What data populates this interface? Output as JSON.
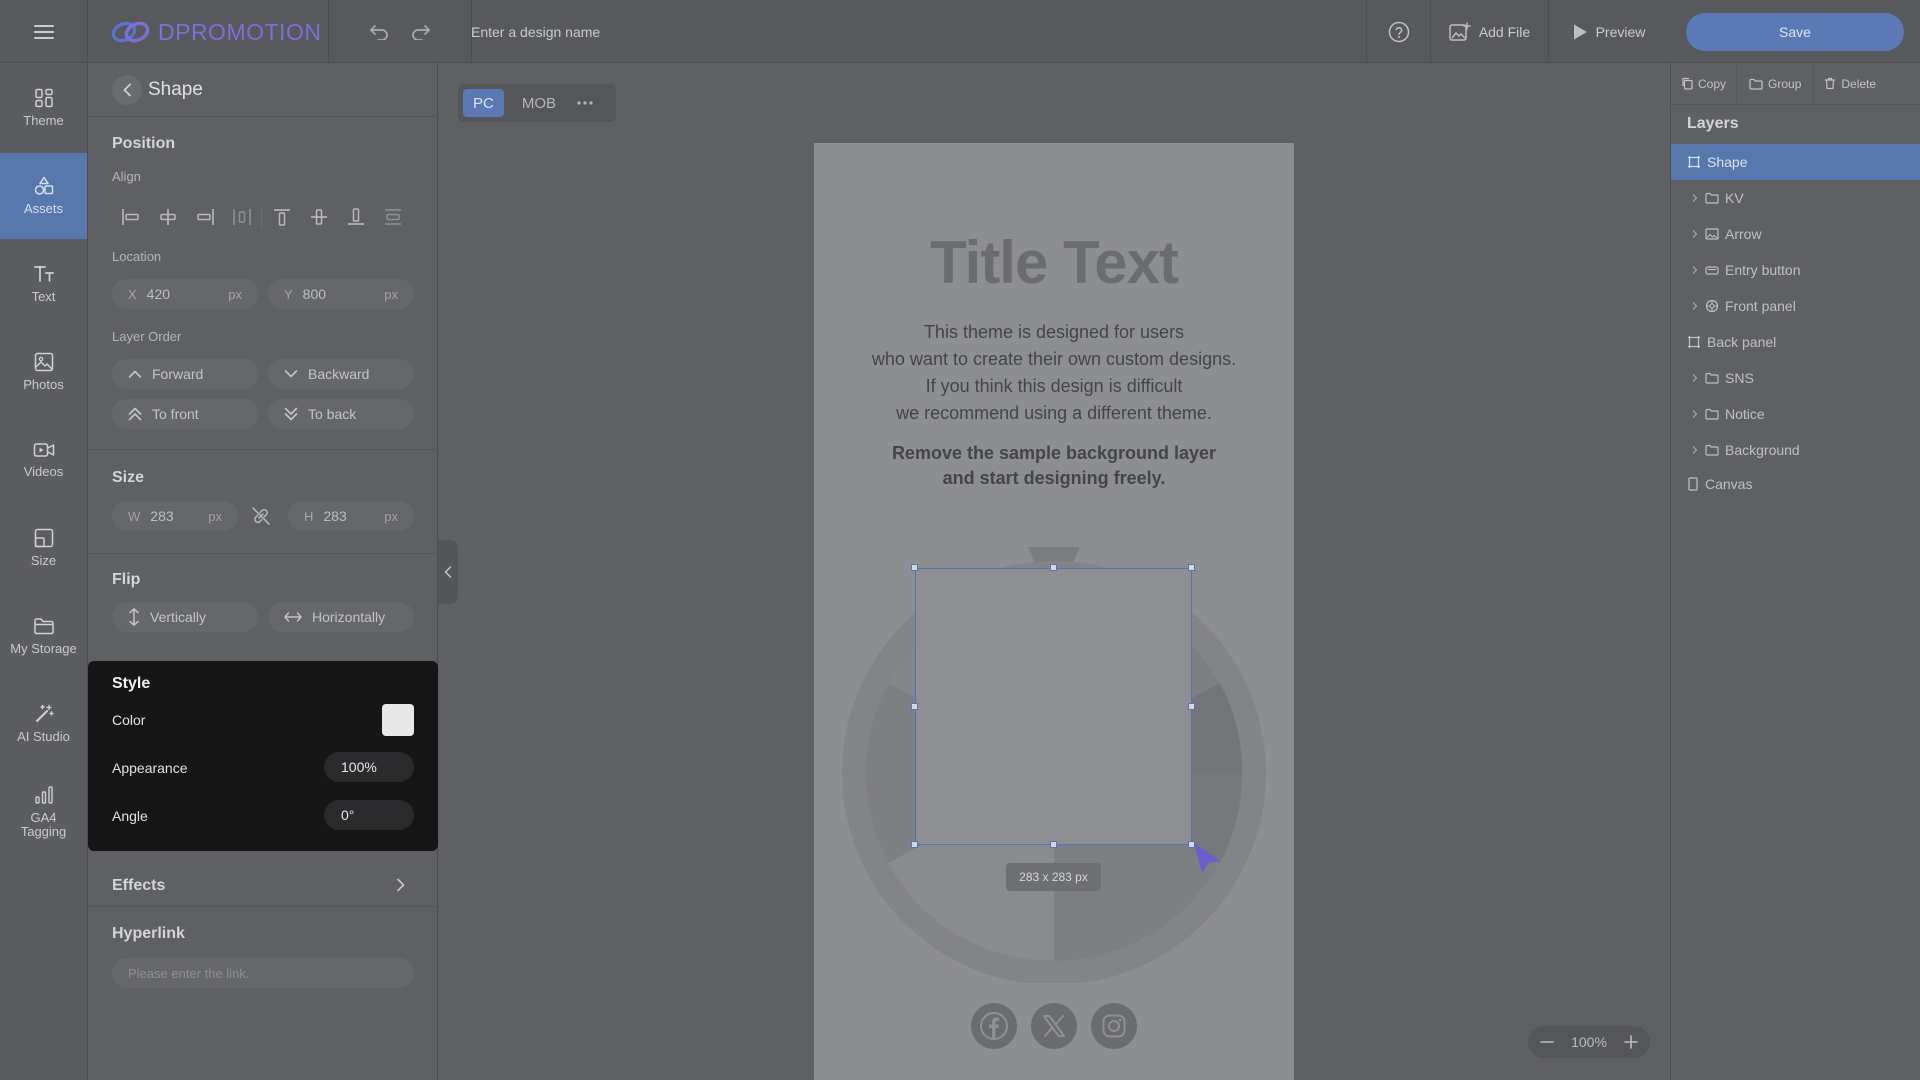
{
  "app": {
    "logo_text": "DPROMOTION",
    "design_name_placeholder": "Enter a design name",
    "add_file_label": "Add File",
    "preview_label": "Preview",
    "save_label": "Save"
  },
  "rail": {
    "items": [
      {
        "label": "Theme",
        "icon": "theme-icon",
        "active": false
      },
      {
        "label": "Assets",
        "icon": "assets-icon",
        "active": true
      },
      {
        "label": "Text",
        "icon": "text-icon",
        "active": false
      },
      {
        "label": "Photos",
        "icon": "photos-icon",
        "active": false
      },
      {
        "label": "Videos",
        "icon": "videos-icon",
        "active": false
      },
      {
        "label": "Size",
        "icon": "size-icon",
        "active": false
      },
      {
        "label": "My Storage",
        "icon": "folder-icon",
        "active": false
      },
      {
        "label": "AI Studio",
        "icon": "magic-wand-icon",
        "active": false
      },
      {
        "label": "GA4 Tagging",
        "icon": "bar-chart-icon",
        "active": false
      }
    ]
  },
  "panel": {
    "title": "Shape",
    "position_title": "Position",
    "align_label": "Align",
    "location_label": "Location",
    "x_key": "X",
    "x_value": "420",
    "y_key": "Y",
    "y_value": "800",
    "unit": "px",
    "layer_order_label": "Layer Order",
    "forward_label": "Forward",
    "backward_label": "Backward",
    "to_front_label": "To front",
    "to_back_label": "To back",
    "size_title": "Size",
    "w_key": "W",
    "w_value": "283",
    "h_key": "H",
    "h_value": "283",
    "flip_title": "Flip",
    "vertically_label": "Vertically",
    "horizontally_label": "Horizontally",
    "style_title": "Style",
    "color_label": "Color",
    "color_value": "#e8e8e8",
    "appearance_label": "Appearance",
    "appearance_value": "100%",
    "angle_label": "Angle",
    "angle_value": "0°",
    "effects_title": "Effects",
    "hyperlink_title": "Hyperlink",
    "hyperlink_placeholder": "Please enter the link."
  },
  "canvas": {
    "tabs": [
      "PC",
      "MOB"
    ],
    "active_tab": "PC",
    "title_text": "Title Text",
    "body_lines": [
      "This theme is designed for users",
      "who want to create their own custom designs.",
      "If you think this design is difficult",
      "we recommend using a different theme."
    ],
    "bold_lines": [
      "Remove the sample background layer",
      "and start designing freely."
    ],
    "selection_size": "283 x 283 px",
    "zoom": "100%",
    "social_icons": [
      "facebook-icon",
      "x-icon",
      "instagram-icon"
    ]
  },
  "layers": {
    "copy_label": "Copy",
    "group_label": "Group",
    "delete_label": "Delete",
    "title": "Layers",
    "items": [
      {
        "label": "Shape",
        "icon": "shape-icon",
        "expandable": false,
        "active": true
      },
      {
        "label": "KV",
        "icon": "folder-icon",
        "expandable": true,
        "active": false
      },
      {
        "label": "Arrow",
        "icon": "image-icon",
        "expandable": true,
        "active": false
      },
      {
        "label": "Entry button",
        "icon": "button-icon",
        "expandable": true,
        "active": false
      },
      {
        "label": "Front panel",
        "icon": "gear-icon",
        "expandable": true,
        "active": false
      },
      {
        "label": "Back panel",
        "icon": "shape-icon",
        "expandable": false,
        "active": false
      },
      {
        "label": "SNS",
        "icon": "folder-icon",
        "expandable": true,
        "active": false
      },
      {
        "label": "Notice",
        "icon": "folder-icon",
        "expandable": true,
        "active": false
      },
      {
        "label": "Background",
        "icon": "folder-icon",
        "expandable": true,
        "active": false
      },
      {
        "label": "Canvas",
        "icon": "canvas-icon",
        "expandable": false,
        "active": false
      }
    ]
  },
  "colors": {
    "accent": "#5877ad",
    "save_button": "#5b7ab5",
    "logo": "#7e6ed8",
    "selection": "#5a73b8"
  }
}
